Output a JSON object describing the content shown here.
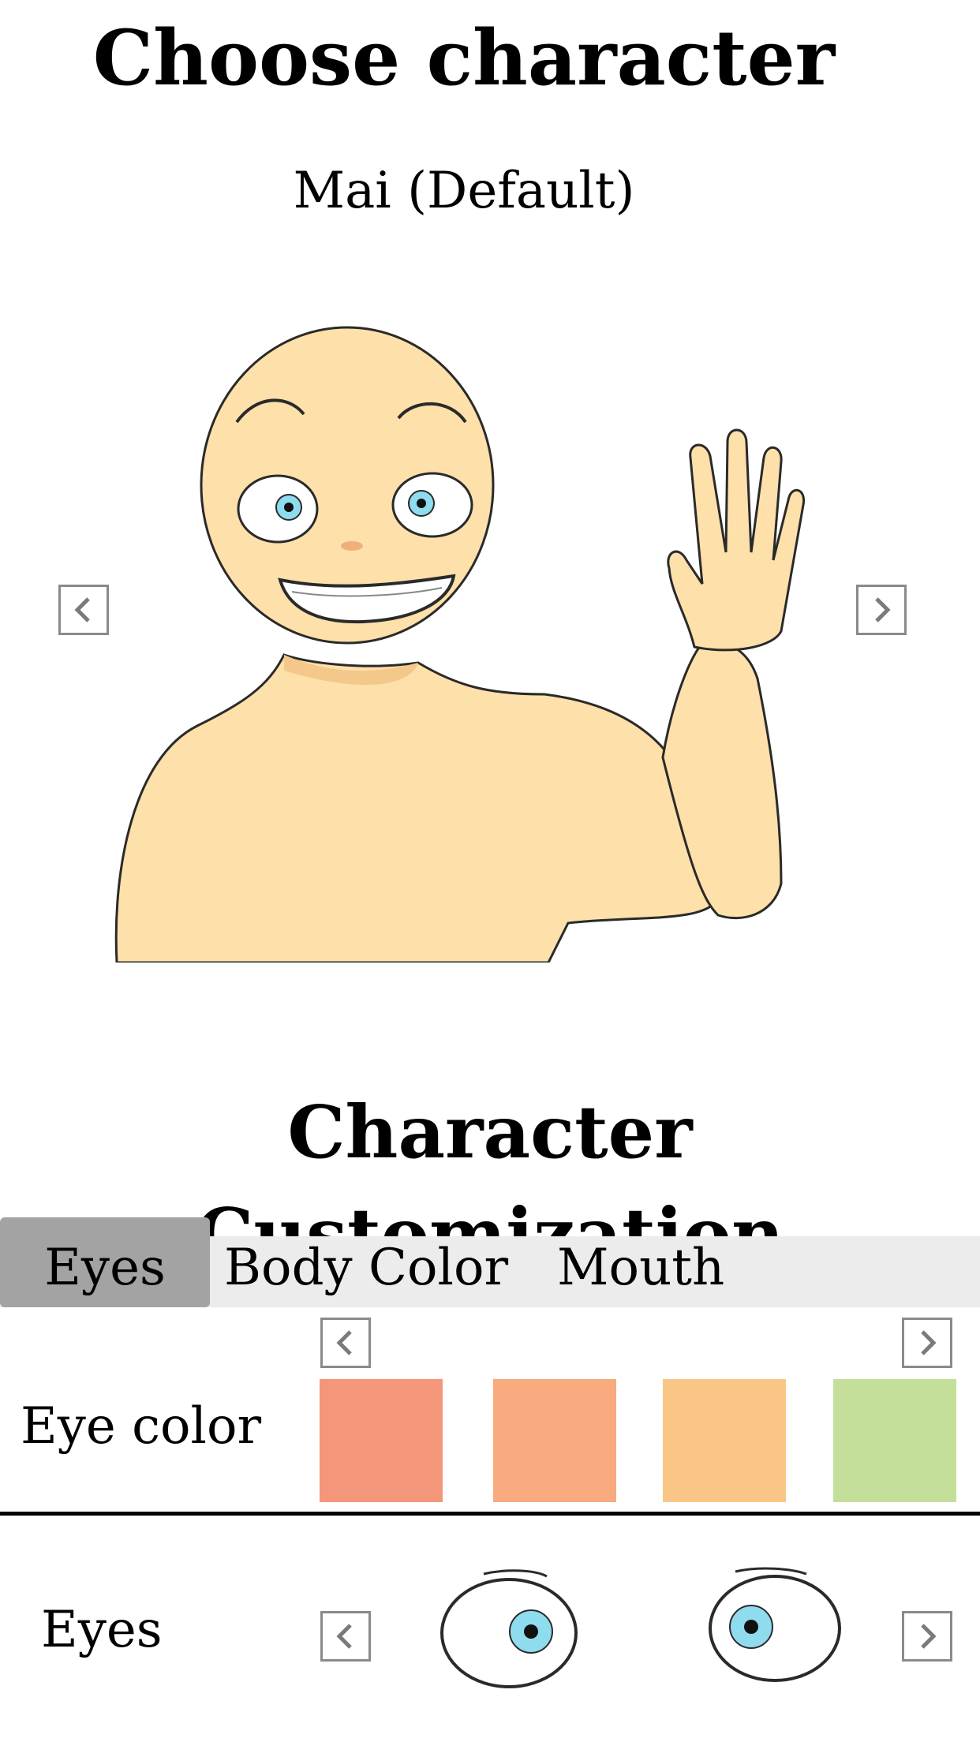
{
  "header": {
    "title": "Choose character",
    "character_name": "Mai (Default)"
  },
  "customization": {
    "title": "Character Customization",
    "tabs": [
      {
        "label": "Eyes",
        "active": true
      },
      {
        "label": "Body Color",
        "active": false
      },
      {
        "label": "Mouth",
        "active": false
      }
    ],
    "eye_color": {
      "label": "Eye color",
      "swatches": [
        "#f4967a",
        "#f7ab7e",
        "#f9c688",
        "#c4df9a"
      ]
    },
    "eyes": {
      "label": "Eyes"
    }
  },
  "colors": {
    "skin": "#fde0aa",
    "skin_shadow": "#f4c88a",
    "iris": "#8fdcee",
    "tab_active": "#a3a3a3",
    "tab_bar": "#ececec",
    "arrow_border": "#8a8a8a"
  },
  "icons": {
    "prev": "chevron-left-icon",
    "next": "chevron-right-icon"
  }
}
